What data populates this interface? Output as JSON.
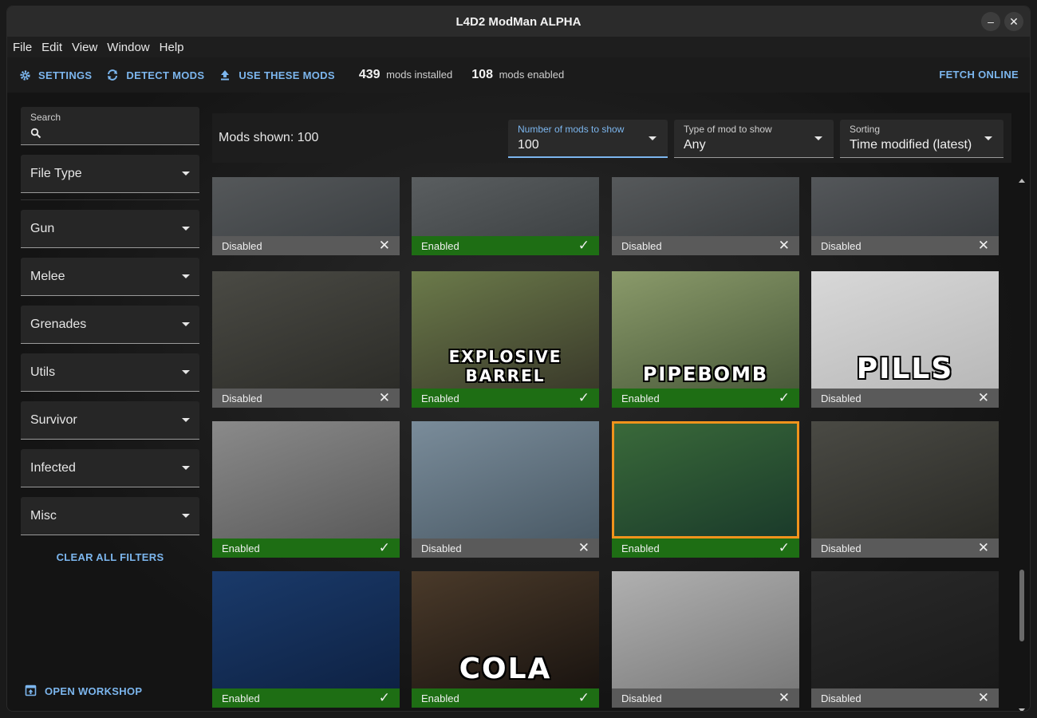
{
  "window": {
    "title": "L4D2 ModMan ALPHA",
    "minimize": "–",
    "close": "✕"
  },
  "menu": [
    "File",
    "Edit",
    "View",
    "Window",
    "Help"
  ],
  "toolbar": {
    "settings": "SETTINGS",
    "detect": "DETECT MODS",
    "use": "USE THESE MODS",
    "installed_count": "439",
    "installed_label": "mods installed",
    "enabled_count": "108",
    "enabled_label": "mods enabled",
    "fetch": "FETCH ONLINE"
  },
  "sidebar": {
    "search_label": "Search",
    "file_type": "File Type",
    "filters": [
      "Gun",
      "Melee",
      "Grenades",
      "Utils",
      "Survivor",
      "Infected",
      "Misc"
    ],
    "clear": "CLEAR ALL FILTERS",
    "workshop": "OPEN WORKSHOP"
  },
  "header": {
    "shown": "Mods shown: 100",
    "num": {
      "label": "Number of mods to show",
      "value": "100"
    },
    "type": {
      "label": "Type of mod to show",
      "value": "Any"
    },
    "sort": {
      "label": "Sorting",
      "value": "Time modified (latest)"
    }
  },
  "mods": [
    {
      "status": "Disabled",
      "enabled": false,
      "text": "",
      "colors": [
        "#55585a",
        "#3c4043"
      ]
    },
    {
      "status": "Enabled",
      "enabled": true,
      "text": "",
      "colors": [
        "#5a5e60",
        "#3e4244"
      ]
    },
    {
      "status": "Disabled",
      "enabled": false,
      "text": "",
      "colors": [
        "#56595b",
        "#3b3e40"
      ]
    },
    {
      "status": "Disabled",
      "enabled": false,
      "text": "",
      "colors": [
        "#54575a",
        "#3a3d40"
      ]
    },
    {
      "status": "Disabled",
      "enabled": false,
      "text": "",
      "colors": [
        "#4a4a44",
        "#2c2c28"
      ]
    },
    {
      "status": "Enabled",
      "enabled": true,
      "text": "EXPLOSIVE BARREL",
      "colors": [
        "#6b7a4a",
        "#3a3a2a"
      ]
    },
    {
      "status": "Enabled",
      "enabled": true,
      "text": "PIPEBOMB",
      "colors": [
        "#8a9a6a",
        "#4a5a3a"
      ]
    },
    {
      "status": "Disabled",
      "enabled": false,
      "text": "PILLS",
      "colors": [
        "#d8d8d8",
        "#b8b8b8"
      ]
    },
    {
      "status": "Enabled",
      "enabled": true,
      "text": "",
      "colors": [
        "#8a8a8a",
        "#5a5a5a"
      ]
    },
    {
      "status": "Disabled",
      "enabled": false,
      "text": "",
      "colors": [
        "#7a8c9a",
        "#4a5a66"
      ]
    },
    {
      "status": "Enabled",
      "enabled": true,
      "text": "",
      "colors": [
        "#3a6a3a",
        "#1a3a2a"
      ],
      "selected": true
    },
    {
      "status": "Disabled",
      "enabled": false,
      "text": "",
      "colors": [
        "#4a4a44",
        "#2a2a26"
      ]
    },
    {
      "status": "Enabled",
      "enabled": true,
      "text": "",
      "colors": [
        "#1a3a6a",
        "#0e2244"
      ]
    },
    {
      "status": "Enabled",
      "enabled": true,
      "text": "COLA",
      "colors": [
        "#4a3a2a",
        "#1a1410"
      ]
    },
    {
      "status": "Disabled",
      "enabled": false,
      "text": "",
      "colors": [
        "#b0b0b0",
        "#7a7a7a"
      ]
    },
    {
      "status": "Disabled",
      "enabled": false,
      "text": "",
      "colors": [
        "#2a2a2a",
        "#1a1a1a"
      ]
    }
  ],
  "colors": {
    "accent": "#7cb6ee",
    "enabled": "#1e6e14",
    "disabled": "#5a5a5a",
    "selected": "#f0931c"
  }
}
